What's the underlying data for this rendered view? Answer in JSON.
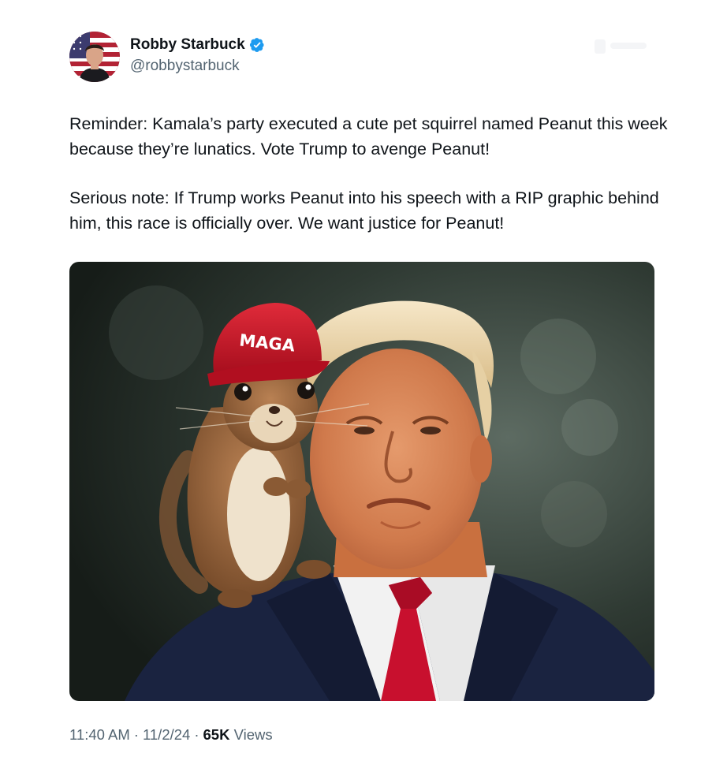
{
  "tweet": {
    "author": {
      "display_name": "Robby Starbuck",
      "handle": "@robbystarbuck",
      "verified_icon": "verified-badge-icon",
      "verified_color": "#1d9bf0"
    },
    "paragraphs": [
      "Reminder: Kamala’s party executed a cute pet squirrel named Peanut this week because they’re lunatics. Vote Trump to avenge Peanut!",
      "Serious note: If Trump works Peanut into his speech with a RIP graphic behind him, this race is officially over. We want justice for Peanut!"
    ],
    "media": {
      "hat_text": "MAGA"
    },
    "meta": {
      "time": "11:40 AM",
      "separator": "·",
      "date": "11/2/24",
      "views_count": "65K",
      "views_label": "Views"
    }
  },
  "colors": {
    "text_primary": "#0f1419",
    "text_secondary": "#536471",
    "hat_red": "#c8102e",
    "suit_navy": "#1a2340"
  }
}
